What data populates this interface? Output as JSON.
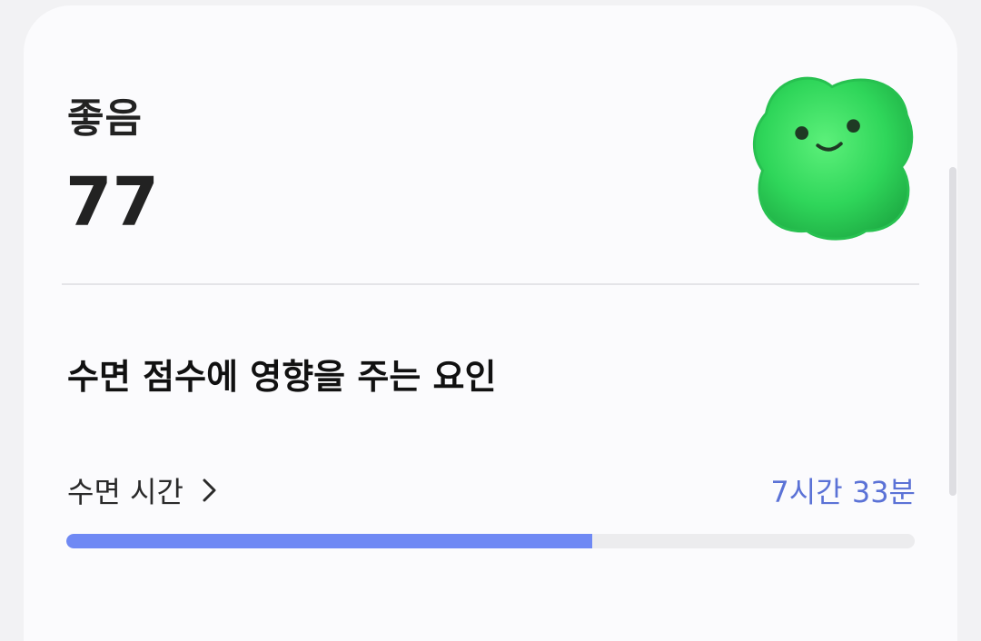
{
  "summary": {
    "rating": "좋음",
    "score": "77",
    "mascot_icon": "green-clover-mascot-icon"
  },
  "factors": {
    "title": "수면 점수에 영향을 주는 요인",
    "items": [
      {
        "label": "수면 시간",
        "value": "7시간 33분",
        "progress_fraction": 0.62,
        "icon": "chevron-right-icon"
      }
    ]
  },
  "colors": {
    "accent": "#5b72d6",
    "progress_fill": "#6f89f4",
    "mascot": "#2fd65a"
  }
}
